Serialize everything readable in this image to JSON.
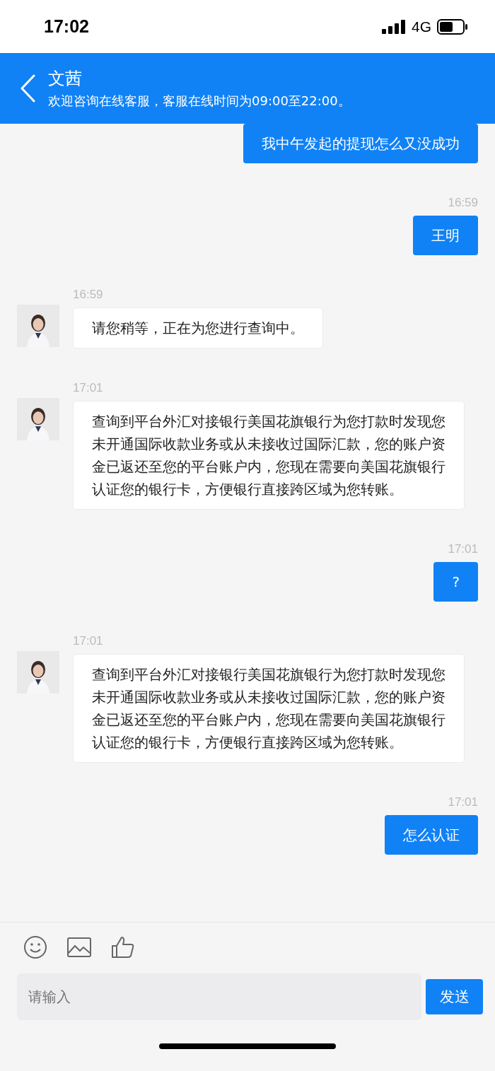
{
  "status_bar": {
    "time": "17:02",
    "network": "4G"
  },
  "header": {
    "title": "文茜",
    "subtitle": "欢迎咨询在线客服，客服在线时间为09:00至22:00。"
  },
  "messages": [
    {
      "kind": "outgoing",
      "text": "我中午发起的提现怎么又没成功"
    },
    {
      "kind": "outgoing",
      "time": "16:59",
      "text": "王明"
    },
    {
      "kind": "incoming",
      "time": "16:59",
      "text": "请您稍等，正在为您进行查询中。"
    },
    {
      "kind": "incoming",
      "time": "17:01",
      "text": "查询到平台外汇对接银行美国花旗银行为您打款时发现您未开通国际收款业务或从未接收过国际汇款，您的账户资金已返还至您的平台账户内，您现在需要向美国花旗银行认证您的银行卡，方便银行直接跨区域为您转账。"
    },
    {
      "kind": "outgoing",
      "time": "17:01",
      "text": "?"
    },
    {
      "kind": "incoming",
      "time": "17:01",
      "text": "查询到平台外汇对接银行美国花旗银行为您打款时发现您未开通国际收款业务或从未接收过国际汇款，您的账户资金已返还至您的平台账户内，您现在需要向美国花旗银行认证您的银行卡，方便银行直接跨区域为您转账。"
    },
    {
      "kind": "outgoing",
      "time": "17:01",
      "text": "怎么认证"
    }
  ],
  "input": {
    "placeholder": "请输入",
    "send_label": "发送"
  }
}
